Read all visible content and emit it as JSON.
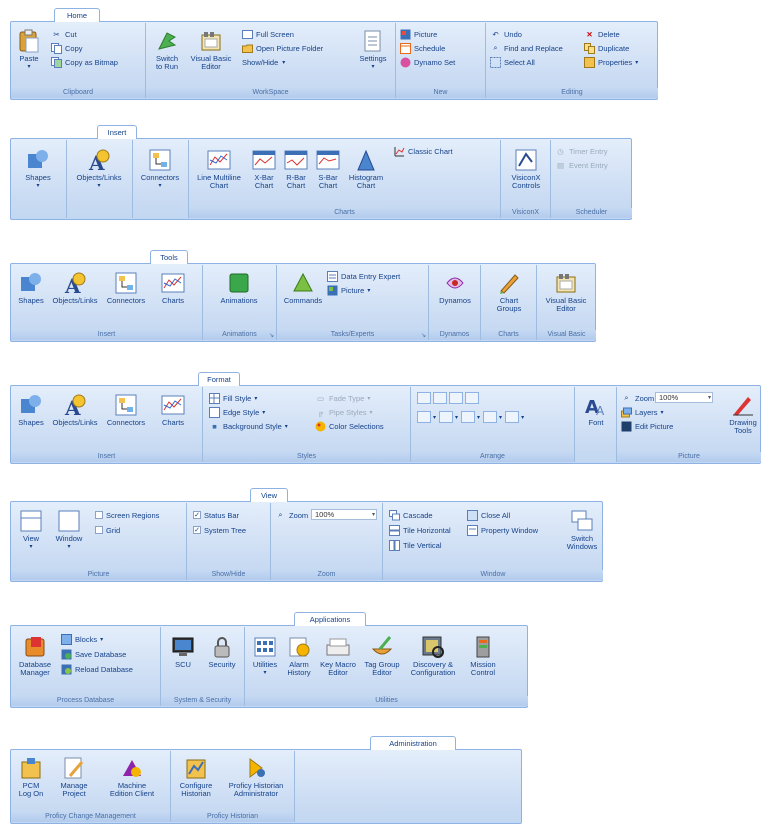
{
  "home": {
    "tab": "Home",
    "paste": "Paste",
    "cut": "Cut",
    "copy": "Copy",
    "copy_bitmap": "Copy as Bitmap",
    "clipboard": "Clipboard",
    "switch_run": "Switch\nto Run",
    "vb_editor": "Visual Basic\nEditor",
    "full_screen": "Full Screen",
    "open_picture_folder": "Open Picture Folder",
    "show_hide": "Show/Hide",
    "settings": "Settings",
    "workspace": "WorkSpace",
    "picture": "Picture",
    "schedule": "Schedule",
    "dynamo_set": "Dynamo Set",
    "new": "New",
    "undo": "Undo",
    "delete": "Delete",
    "find_replace": "Find and Replace",
    "duplicate": "Duplicate",
    "select_all": "Select All",
    "properties": "Properties",
    "editing": "Editing"
  },
  "insert": {
    "tab": "Insert",
    "shapes": "Shapes",
    "objects_links": "Objects/Links",
    "connectors": "Connectors",
    "line_multiline": "Line Multiline\nChart",
    "xbar": "X-Bar\nChart",
    "rbar": "R-Bar\nChart",
    "sbar": "S-Bar\nChart",
    "histogram": "Histogram\nChart",
    "classic_chart": "Classic Chart",
    "charts": "Charts",
    "visiconx_controls": "VisiconX\nControls",
    "visiconx": "VisiconX",
    "timer_entry": "Timer Entry",
    "event_entry": "Event Entry",
    "scheduler": "Scheduler"
  },
  "tools": {
    "tab": "Tools",
    "shapes": "Shapes",
    "objects_links": "Objects/Links",
    "connectors": "Connectors",
    "charts": "Charts",
    "insert": "Insert",
    "animations": "Animations",
    "animations_group": "Animations",
    "commands": "Commands",
    "data_entry_expert": "Data Entry Expert",
    "picture": "Picture",
    "tasks_experts": "Tasks/Experts",
    "dynamos": "Dynamos",
    "dynamos_group": "Dynamos",
    "chart_groups": "Chart\nGroups",
    "charts_group": "Charts",
    "vb_editor": "Visual Basic\nEditor",
    "visual_basic": "Visual Basic"
  },
  "format": {
    "tab": "Format",
    "shapes": "Shapes",
    "objects_links": "Objects/Links",
    "connectors": "Connectors",
    "charts": "Charts",
    "insert": "Insert",
    "fill_style": "Fill Style",
    "edge_style": "Edge Style",
    "background_style": "Background Style",
    "fade_type": "Fade Type",
    "pipe_styles": "Pipe Styles",
    "color_selections": "Color Selections",
    "styles": "Styles",
    "arrange": "Arrange",
    "font": "Font",
    "zoom": "Zoom",
    "zoom_value": "100%",
    "layers": "Layers",
    "edit_picture": "Edit Picture",
    "drawing_tools": "Drawing\nTools",
    "picture": "Picture"
  },
  "view": {
    "tab": "View",
    "view": "View",
    "window": "Window",
    "screen_regions": "Screen Regions",
    "grid": "Grid",
    "picture": "Picture",
    "status_bar": "Status Bar",
    "system_tree": "System Tree",
    "show_hide": "Show/Hide",
    "zoom": "Zoom",
    "zoom_value": "100%",
    "zoom_group": "Zoom",
    "cascade": "Cascade",
    "close_all": "Close All",
    "tile_horizontal": "Tile Horizontal",
    "property_window": "Property Window",
    "tile_vertical": "Tile Vertical",
    "switch_windows": "Switch\nWindows",
    "window_group": "Window"
  },
  "applications": {
    "tab": "Applications",
    "database_manager": "Database\nManager",
    "blocks": "Blocks",
    "save_database": "Save Database",
    "reload_database": "Reload Database",
    "process_database": "Process Database",
    "scu": "SCU",
    "security": "Security",
    "system_security": "System & Security",
    "utilities": "Utilities",
    "alarm_history": "Alarm\nHistory",
    "key_macro_editor": "Key Macro\nEditor",
    "tag_group_editor": "Tag Group\nEditor",
    "discovery_config": "Discovery &\nConfiguration",
    "mission_control": "Mission\nControl",
    "utilities_group": "Utilities"
  },
  "administration": {
    "tab": "Administration",
    "pcm_logon": "PCM\nLog On",
    "manage_project": "Manage\nProject",
    "machine_edition_client": "Machine\nEdition Client",
    "proficy_change_mgmt": "Proficy Change Management",
    "configure_historian": "Configure\nHistorian",
    "proficy_historian_admin": "Proficy Historian\nAdministrator",
    "proficy_historian": "Proficy Historian"
  },
  "colors": {
    "ribbon_top": "#e4eefb",
    "ribbon_bottom": "#c2d7f1",
    "border": "#8db2e3",
    "text": "#15428b",
    "group_label": "#4a6fa5"
  }
}
